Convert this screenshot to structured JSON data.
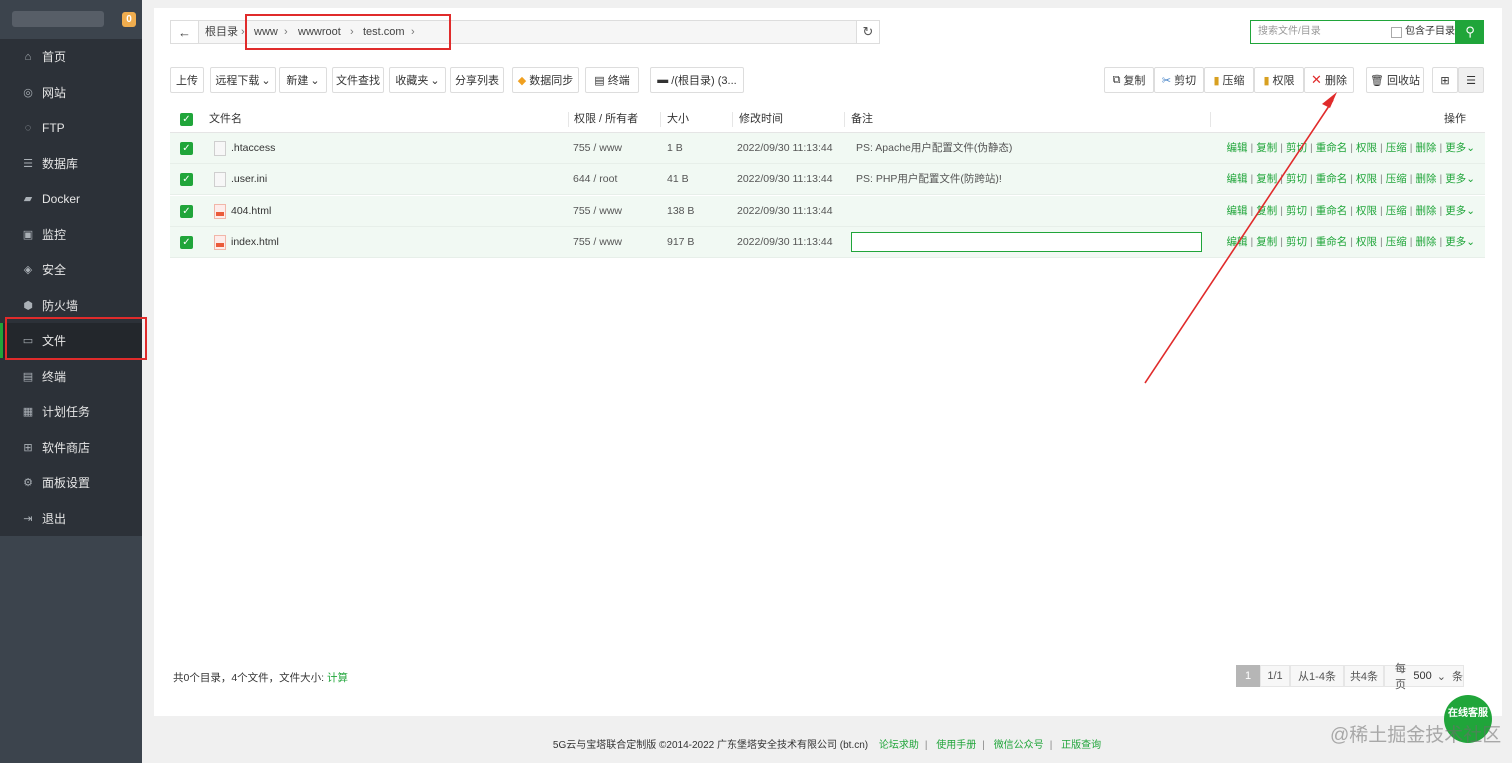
{
  "sidebar": {
    "badge": "0",
    "items": [
      {
        "label": "首页",
        "icon": "home-icon"
      },
      {
        "label": "网站",
        "icon": "globe-icon"
      },
      {
        "label": "FTP",
        "icon": "ftp-icon"
      },
      {
        "label": "数据库",
        "icon": "database-icon"
      },
      {
        "label": "Docker",
        "icon": "docker-icon"
      },
      {
        "label": "监控",
        "icon": "monitor-icon"
      },
      {
        "label": "安全",
        "icon": "shield-icon"
      },
      {
        "label": "防火墙",
        "icon": "firewall-icon"
      },
      {
        "label": "文件",
        "icon": "folder-icon"
      },
      {
        "label": "终端",
        "icon": "terminal-icon"
      },
      {
        "label": "计划任务",
        "icon": "calendar-icon"
      },
      {
        "label": "软件商店",
        "icon": "apps-icon"
      },
      {
        "label": "面板设置",
        "icon": "gear-icon"
      },
      {
        "label": "退出",
        "icon": "logout-icon"
      }
    ]
  },
  "path": {
    "root": "根目录",
    "segments": [
      "www",
      "wwwroot",
      "test.com"
    ]
  },
  "search": {
    "placeholder": "搜索文件/目录",
    "include_sub": "包含子目录"
  },
  "toolbar": {
    "upload": "上传",
    "remote_download": "远程下载",
    "new": "新建",
    "file_search": "文件查找",
    "favorites": "收藏夹",
    "share_list": "分享列表",
    "data_sync": "数据同步",
    "terminal": "终端",
    "disk": "/(根目录) (3...",
    "copy": "复制",
    "cut": "剪切",
    "compress": "压缩",
    "permission": "权限",
    "delete": "删除",
    "recycle": "回收站"
  },
  "table": {
    "headers": {
      "name": "文件名",
      "perm": "权限 / 所有者",
      "size": "大小",
      "mtime": "修改时间",
      "remark": "备注",
      "ops": "操作"
    },
    "rows": [
      {
        "name": ".htaccess",
        "perm": "755 / www",
        "size": "1 B",
        "mtime": "2022/09/30 11:13:44",
        "remark": "PS: Apache用户配置文件(伪静态)",
        "type": "text"
      },
      {
        "name": ".user.ini",
        "perm": "644 / root",
        "size": "41 B",
        "mtime": "2022/09/30 11:13:44",
        "remark": "PS: PHP用户配置文件(防跨站)!",
        "type": "text"
      },
      {
        "name": "404.html",
        "perm": "755 / www",
        "size": "138 B",
        "mtime": "2022/09/30 11:13:44",
        "remark": "",
        "type": "html"
      },
      {
        "name": "index.html",
        "perm": "755 / www",
        "size": "917 B",
        "mtime": "2022/09/30 11:13:44",
        "remark": "",
        "type": "html"
      }
    ],
    "ops": [
      "编辑",
      "复制",
      "剪切",
      "重命名",
      "权限",
      "压缩",
      "删除",
      "更多"
    ]
  },
  "summary": {
    "text": "共0个目录，4个文件，文件大小:",
    "calc": "计算"
  },
  "pager": {
    "current": "1",
    "pages": "1/1",
    "range": "从1-4条",
    "total": "共4条",
    "per_page_label": "每页",
    "per_page": "500",
    "unit": "条"
  },
  "footer": {
    "copyright": "5G云与宝塔联合定制版 ©2014-2022 广东堡塔安全技术有限公司 (bt.cn)",
    "links": [
      "论坛求助",
      "使用手册",
      "微信公众号",
      "正版查询"
    ]
  },
  "online_service": "在线客服",
  "watermark": "@稀土掘金技术社区",
  "colors": {
    "accent": "#20a53a",
    "sidebar": "#2c3138",
    "highlight": "#e02b2b"
  }
}
